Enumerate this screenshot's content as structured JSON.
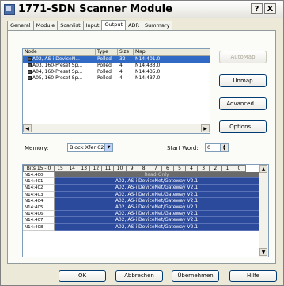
{
  "window": {
    "title": "1771-SDN Scanner Module",
    "help_glyph": "?",
    "close_glyph": "X"
  },
  "tabs": [
    "General",
    "Module",
    "Scanlist",
    "Input",
    "Output",
    "ADR",
    "Summary"
  ],
  "active_tab": "Output",
  "device_list": {
    "columns": [
      "Node",
      "Type",
      "Size",
      "Map"
    ],
    "rows": [
      {
        "node": "A02, AS-i DeviceN...",
        "type": "Polled",
        "size": "32",
        "map": "N14:401.0"
      },
      {
        "node": "A03, 160-Preset Sp...",
        "type": "Polled",
        "size": "4",
        "map": "N14:433.0"
      },
      {
        "node": "A04, 160-Preset Sp...",
        "type": "Polled",
        "size": "4",
        "map": "N14:435.0"
      },
      {
        "node": "A05, 160-Preset Sp...",
        "type": "Polled",
        "size": "4",
        "map": "N14:437.0"
      }
    ]
  },
  "side_buttons": {
    "automap": "AutoMap",
    "unmap": "Unmap",
    "advanced": "Advanced...",
    "options": "Options..."
  },
  "memory": {
    "label": "Memory:",
    "value": "Block Xfer 62",
    "start_word_label": "Start Word:",
    "start_word_value": "0"
  },
  "bit_grid": {
    "header": [
      "Bits 15 - 0",
      "15",
      "14",
      "13",
      "12",
      "11",
      "10",
      "9",
      "8",
      "7",
      "6",
      "5",
      "4",
      "3",
      "2",
      "1",
      "0"
    ],
    "rows": [
      {
        "addr": "N14:400",
        "value": "Read-Only"
      },
      {
        "addr": "N14:401",
        "value": "A02, AS-i DeviceNet/Gateway V2.1"
      },
      {
        "addr": "N14:402",
        "value": "A02, AS-i DeviceNet/Gateway V2.1"
      },
      {
        "addr": "N14:403",
        "value": "A02, AS-i DeviceNet/Gateway V2.1"
      },
      {
        "addr": "N14:404",
        "value": "A02, AS-i DeviceNet/Gateway V2.1"
      },
      {
        "addr": "N14:405",
        "value": "A02, AS-i DeviceNet/Gateway V2.1"
      },
      {
        "addr": "N14:406",
        "value": "A02, AS-i DeviceNet/Gateway V2.1"
      },
      {
        "addr": "N14:407",
        "value": "A02, AS-i DeviceNet/Gateway V2.1"
      },
      {
        "addr": "N14:408",
        "value": "A02, AS-i DeviceNet/Gateway V2.1"
      }
    ]
  },
  "footer_buttons": {
    "ok": "OK",
    "cancel": "Abbrechen",
    "apply": "Übernehmen",
    "help": "Hilfe"
  },
  "colors": {
    "selection": "#316ac5",
    "mapped_bits": "#2c4a9c",
    "read_only": "#6a6a6a",
    "window_bg": "#ece9d8"
  }
}
